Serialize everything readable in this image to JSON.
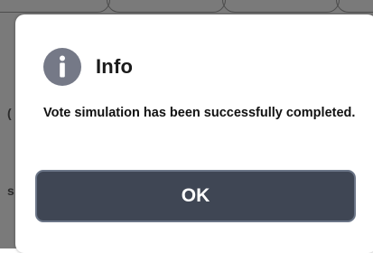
{
  "background": {
    "partial_glyphs": [
      "(",
      "s"
    ]
  },
  "dialog": {
    "icon": "info-icon",
    "title": "Info",
    "message": "Vote simulation has been successfully completed.",
    "ok_label": "OK"
  },
  "colors": {
    "button_bg": "#3f4654",
    "button_border": "#6b7587",
    "icon_bg": "#757987"
  }
}
